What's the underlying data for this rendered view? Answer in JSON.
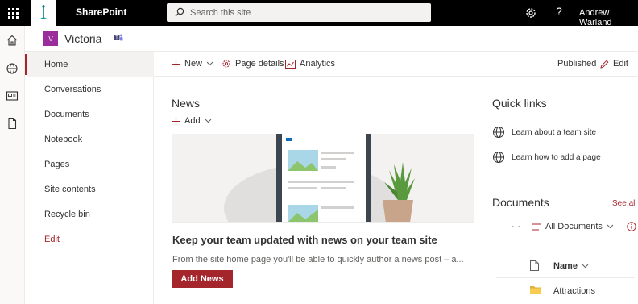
{
  "suite": {
    "brand": "SharePoint",
    "search_placeholder": "Search this site",
    "help_label": "?",
    "user_name": "Andrew Warland"
  },
  "site": {
    "logo_letter": "V",
    "title": "Victoria",
    "logo_color": "#9b2c9b"
  },
  "nav": {
    "items": [
      {
        "label": "Home"
      },
      {
        "label": "Conversations"
      },
      {
        "label": "Documents"
      },
      {
        "label": "Notebook"
      },
      {
        "label": "Pages"
      },
      {
        "label": "Site contents"
      },
      {
        "label": "Recycle bin"
      },
      {
        "label": "Edit"
      }
    ]
  },
  "commandbar": {
    "new_label": "New",
    "page_details_label": "Page details",
    "analytics_label": "Analytics",
    "status": "Published",
    "edit_label": "Edit"
  },
  "news": {
    "title": "News",
    "add_label": "Add",
    "headline": "Keep your team updated with news on your team site",
    "description": "From the site home page you'll be able to quickly author a news post – a...",
    "button_label": "Add News"
  },
  "quick_links": {
    "title": "Quick links",
    "items": [
      {
        "label": "Learn about a team site",
        "icon": "globe-icon"
      },
      {
        "label": "Learn how to add a page",
        "icon": "globe-icon"
      }
    ]
  },
  "documents": {
    "title": "Documents",
    "see_all": "See all",
    "more_label": "···",
    "view_label": "All Documents",
    "column_name": "Name",
    "rows": [
      {
        "name": "Attractions",
        "icon": "folder-icon"
      }
    ]
  },
  "colors": {
    "accent": "#a4262c",
    "suite_bar": "#000000"
  }
}
